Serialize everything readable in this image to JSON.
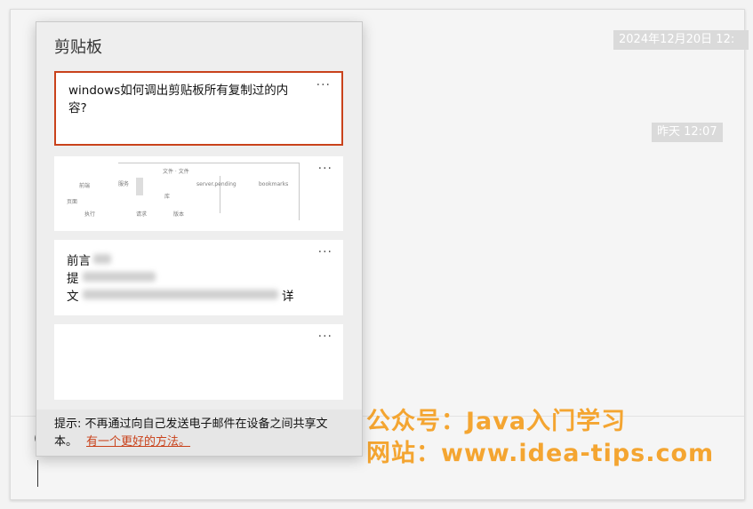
{
  "chat": {
    "timestamps": [
      "2024年12月20日 12:",
      "昨天 12:07"
    ],
    "edge_char": "("
  },
  "clipboard": {
    "title": "剪贴板",
    "more_label": "···",
    "items": [
      {
        "type": "text",
        "text": "windows如何调出剪贴板所有复制过的内容?"
      },
      {
        "type": "image",
        "thumb_title": "文件 · 文件",
        "thumb_labels": [
          "前端",
          "服务",
          "server.pending",
          "bookmarks",
          "页面",
          "库",
          "执行",
          "请求",
          "版本"
        ]
      },
      {
        "type": "text",
        "lines": [
          "前言",
          "提",
          "文",
          "详"
        ]
      },
      {
        "type": "text",
        "text": ""
      }
    ],
    "tip": {
      "text": "提示: 不再通过向自己发送电子邮件在设备之间共享文本。",
      "link": "有一个更好的方法。"
    }
  },
  "watermark": {
    "line1": "公众号：Java入门学习",
    "line2": "网站：www.idea-tips.com"
  },
  "colors": {
    "accent": "#c9421b",
    "watermark": "#f4a531"
  }
}
